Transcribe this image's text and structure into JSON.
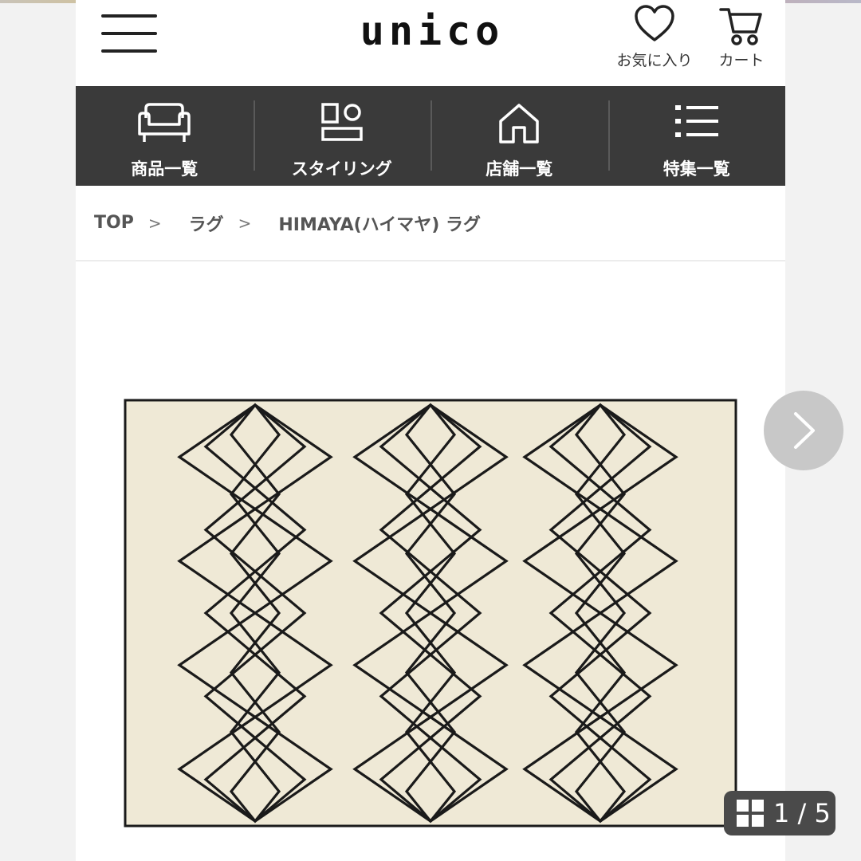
{
  "header": {
    "logo": "unico",
    "menu_icon": "hamburger-menu-icon",
    "favorites_label": "お気に入り",
    "favorites_icon": "heart-icon",
    "cart_label": "カート",
    "cart_icon": "cart-icon"
  },
  "nav": {
    "items": [
      {
        "label": "商品一覧",
        "icon": "sofa-icon"
      },
      {
        "label": "スタイリング",
        "icon": "styling-icon"
      },
      {
        "label": "店舗一覧",
        "icon": "house-icon"
      },
      {
        "label": "特集一覧",
        "icon": "list-icon"
      }
    ],
    "background": "#3a3a3a"
  },
  "breadcrumb": {
    "items": [
      "TOP",
      "ラグ",
      "HIMAYA(ハイマヤ) ラグ"
    ],
    "separator": ">"
  },
  "gallery": {
    "counter": "1 / 5",
    "next_icon": "chevron-right-icon",
    "grid_icon": "grid-icon",
    "rug_color": "#efe9d6",
    "pattern_color": "#1a1a1a"
  }
}
